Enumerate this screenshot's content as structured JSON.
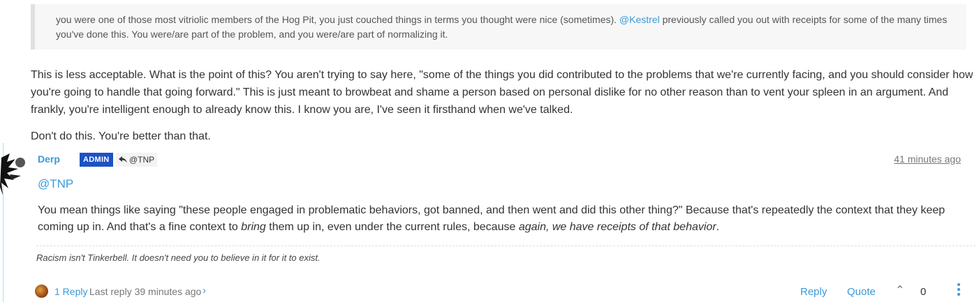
{
  "quote": {
    "before_mention": "you were one of those most vitriolic members of the Hog Pit, you just couched things in terms you thought were nice (sometimes). ",
    "mention": "@Kestrel",
    "after_mention": " previously called you out with receipts for some of the many times you've done this. You were/are part of the problem, and you were/are part of normalizing it."
  },
  "paragraphs": {
    "p1": "This is less acceptable. What is the point of this? You aren't trying to say here, \"some of the things you did contributed to the problems that we're currently facing, and you should consider how you're going to handle that going forward.\" This is just meant to browbeat and shame a person based on personal dislike for no other reason than to vent your spleen in an argument. And frankly, you're intelligent enough to already know this. I know you are, I've seen it firsthand when we've talked.",
    "p2": "Don't do this. You're better than that."
  },
  "post": {
    "username": "Derp",
    "badge": "ADMIN",
    "reply_to": "@TNP",
    "timestamp": "41 minutes ago",
    "mention": "@TNP",
    "body_1": "You mean things like saying \"these people engaged in problematic behaviors, got banned, and then went and did this other thing?\" Because that's repeatedly the context that they keep coming up in. And that's a fine context to ",
    "body_em1": "bring",
    "body_2": " them up in, even under the current rules, because ",
    "body_em2": "again, we have receipts of that behavior",
    "body_3": ".",
    "signature": "Racism isn't Tinkerbell. It doesn't need you to believe in it for it to exist."
  },
  "footer": {
    "replies": "1 Reply",
    "last_reply": "Last reply 39 minutes ago",
    "chevron": "›",
    "reply_label": "Reply",
    "quote_label": "Quote",
    "upvote_glyph": "⌃",
    "votes": "0"
  },
  "colors": {
    "link": "#3a9ad9",
    "admin_badge": "#1c52c4"
  },
  "icons": {
    "reply_to": "reply-arrow-icon",
    "upvote": "upvote-icon",
    "more": "kebab-menu-icon"
  }
}
